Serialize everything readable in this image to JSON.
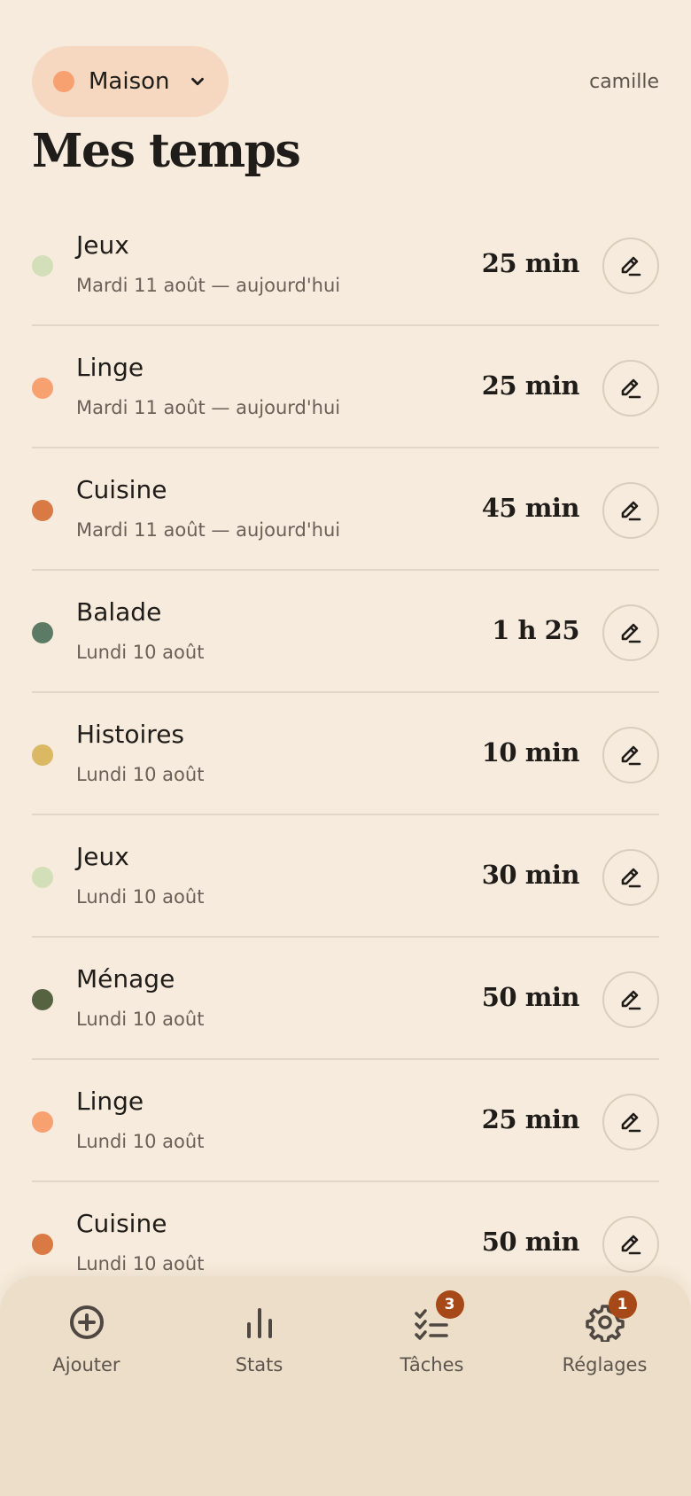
{
  "header": {
    "household_name": "Maison",
    "household_color": "#f7a170",
    "user_name": "camille"
  },
  "page_title": "Mes temps",
  "entries": [
    {
      "task": "Jeux",
      "date": "Mardi 11 août — aujourd'hui",
      "duration": "25 min",
      "color": "#d2dfb8"
    },
    {
      "task": "Linge",
      "date": "Mardi 11 août — aujourd'hui",
      "duration": "25 min",
      "color": "#f7a170"
    },
    {
      "task": "Cuisine",
      "date": "Mardi 11 août — aujourd'hui",
      "duration": "45 min",
      "color": "#d97a45"
    },
    {
      "task": "Balade",
      "date": "Lundi 10 août",
      "duration": "1 h 25",
      "color": "#5b7b67"
    },
    {
      "task": "Histoires",
      "date": "Lundi 10 août",
      "duration": "10 min",
      "color": "#dbb864"
    },
    {
      "task": "Jeux",
      "date": "Lundi 10 août",
      "duration": "30 min",
      "color": "#d2dfb8"
    },
    {
      "task": "Ménage",
      "date": "Lundi 10 août",
      "duration": "50 min",
      "color": "#566340"
    },
    {
      "task": "Linge",
      "date": "Lundi 10 août",
      "duration": "25 min",
      "color": "#f7a170"
    },
    {
      "task": "Cuisine",
      "date": "Lundi 10 août",
      "duration": "50 min",
      "color": "#d97a45"
    }
  ],
  "nav": {
    "add_label": "Ajouter",
    "stats_label": "Stats",
    "tasks_label": "Tâches",
    "tasks_badge": "3",
    "settings_label": "Réglages",
    "settings_badge": "1"
  },
  "icons": {
    "household_chevron": "chevron-down-icon",
    "entry_edit": "pencil-icon",
    "add": "plus-circle-icon",
    "stats": "bar-chart-icon",
    "tasks": "checklist-icon",
    "settings": "gear-icon"
  },
  "colors": {
    "background": "#f6ebdc",
    "household_pill": "#f5d8bf",
    "nav_background": "#ecdec8",
    "badge": "#a64818"
  }
}
